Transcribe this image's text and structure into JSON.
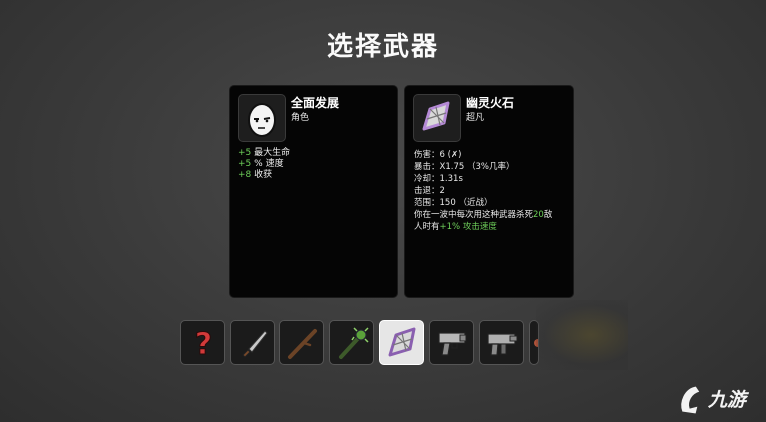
{
  "title": "选择武器",
  "character": {
    "name": "全面发展",
    "type": "角色",
    "stats": [
      {
        "value": "+5",
        "label": "最大生命"
      },
      {
        "value": "+5",
        "label": "% 速度"
      },
      {
        "value": "+8",
        "label": "收获"
      }
    ]
  },
  "weapon": {
    "name": "幽灵火石",
    "tier": "超凡",
    "damage_label": "伤害：",
    "damage_value": "6 (",
    "damage_tail": ")",
    "crit_label": "暴击：",
    "crit_value": "X1.75 （3%几率）",
    "cooldown_label": "冷却：",
    "cooldown_value": "1.31s",
    "knockback_label": "击退：",
    "knockback_value": "2",
    "range_label": "范围：",
    "range_value": "150 （近战）",
    "effect_line1_a": "你在一波中每次用这种武器杀死",
    "effect_line1_num": "20",
    "effect_line1_b": "敌",
    "effect_line2_a": "人时有",
    "effect_line2_green": "+1% 攻击速度"
  },
  "weapon_slots": [
    {
      "icon": "question-icon"
    },
    {
      "icon": "knife-icon"
    },
    {
      "icon": "stick-icon"
    },
    {
      "icon": "thorn-club-icon"
    },
    {
      "icon": "ghost-flint-icon",
      "selected": true
    },
    {
      "icon": "pistol-icon"
    },
    {
      "icon": "smg-icon"
    },
    {
      "icon": "partial-icon"
    }
  ],
  "watermark": {
    "text": "九游"
  }
}
